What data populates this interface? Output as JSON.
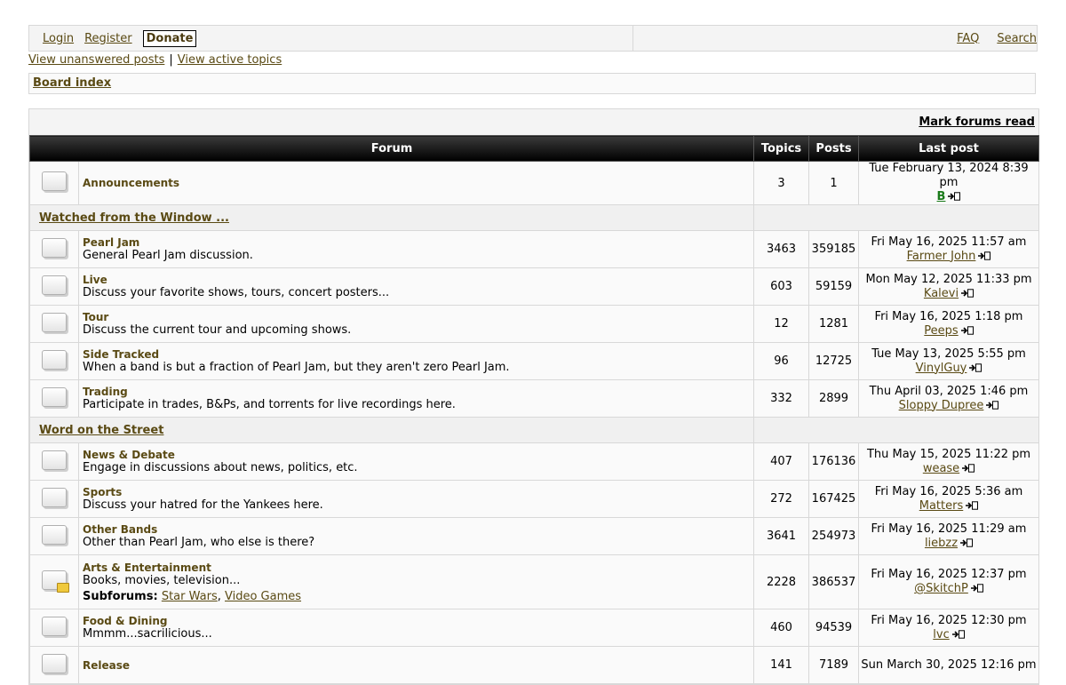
{
  "nav": {
    "login": "Login",
    "register": "Register",
    "donate": "Donate",
    "faq": "FAQ",
    "search": "Search"
  },
  "quick_links": {
    "unanswered": "View unanswered posts",
    "separator": "|",
    "active": "View active topics"
  },
  "breadcrumb": {
    "board_index": "Board index"
  },
  "mark_read": "Mark forums read",
  "headers": {
    "forum": "Forum",
    "topics": "Topics",
    "posts": "Posts",
    "last_post": "Last post"
  },
  "announcements": {
    "name": "Announcements",
    "topics": "3",
    "posts": "1",
    "last_date": "Tue February 13, 2024 8:39 pm",
    "last_user": "B"
  },
  "categories": [
    {
      "name": "Watched from the Window ...",
      "forums": [
        {
          "name": "Pearl Jam",
          "desc": "General Pearl Jam discussion.",
          "topics": "3463",
          "posts": "359185",
          "last_date": "Fri May 16, 2025 11:57 am",
          "last_user": "Farmer John"
        },
        {
          "name": "Live",
          "desc": "Discuss your favorite shows, tours, concert posters...",
          "topics": "603",
          "posts": "59159",
          "last_date": "Mon May 12, 2025 11:33 pm",
          "last_user": "Kalevi"
        },
        {
          "name": "Tour",
          "desc": "Discuss the current tour and upcoming shows.",
          "topics": "12",
          "posts": "1281",
          "last_date": "Fri May 16, 2025 1:18 pm",
          "last_user": "Peeps"
        },
        {
          "name": "Side Tracked",
          "desc": "When a band is but a fraction of Pearl Jam, but they aren't zero Pearl Jam.",
          "topics": "96",
          "posts": "12725",
          "last_date": "Tue May 13, 2025 5:55 pm",
          "last_user": "VinylGuy"
        },
        {
          "name": "Trading",
          "desc": "Participate in trades, B&Ps, and torrents for live recordings here.",
          "topics": "332",
          "posts": "2899",
          "last_date": "Thu April 03, 2025 1:46 pm",
          "last_user": "Sloppy Dupree"
        }
      ]
    },
    {
      "name": "Word on the Street",
      "forums": [
        {
          "name": "News & Debate",
          "desc": "Engage in discussions about news, politics, etc.",
          "topics": "407",
          "posts": "176136",
          "last_date": "Thu May 15, 2025 11:22 pm",
          "last_user": "wease"
        },
        {
          "name": "Sports",
          "desc": "Discuss your hatred for the Yankees here.",
          "topics": "272",
          "posts": "167425",
          "last_date": "Fri May 16, 2025 5:36 am",
          "last_user": "Matters"
        },
        {
          "name": "Other Bands",
          "desc": "Other than Pearl Jam, who else is there?",
          "topics": "3641",
          "posts": "254973",
          "last_date": "Fri May 16, 2025 11:29 am",
          "last_user": "liebzz"
        },
        {
          "name": "Arts & Entertainment",
          "desc": "Books, movies, television...",
          "subforums_label": "Subforums:",
          "subforums": [
            "Star Wars",
            "Video Games"
          ],
          "topics": "2228",
          "posts": "386537",
          "last_date": "Fri May 16, 2025 12:37 pm",
          "last_user": "@SkitchP"
        },
        {
          "name": "Food & Dining",
          "desc": "Mmmm...sacrilicious...",
          "topics": "460",
          "posts": "94539",
          "last_date": "Fri May 16, 2025 12:30 pm",
          "last_user": "lvc"
        },
        {
          "name": "Release",
          "desc": "",
          "topics": "141",
          "posts": "7189",
          "last_date": "Sun March 30, 2025 12:16 pm",
          "last_user": ""
        }
      ]
    }
  ],
  "colors": {
    "accent_link": "#5a4a14",
    "header_bg": "#000000",
    "user_green": "#1a7a1a"
  }
}
